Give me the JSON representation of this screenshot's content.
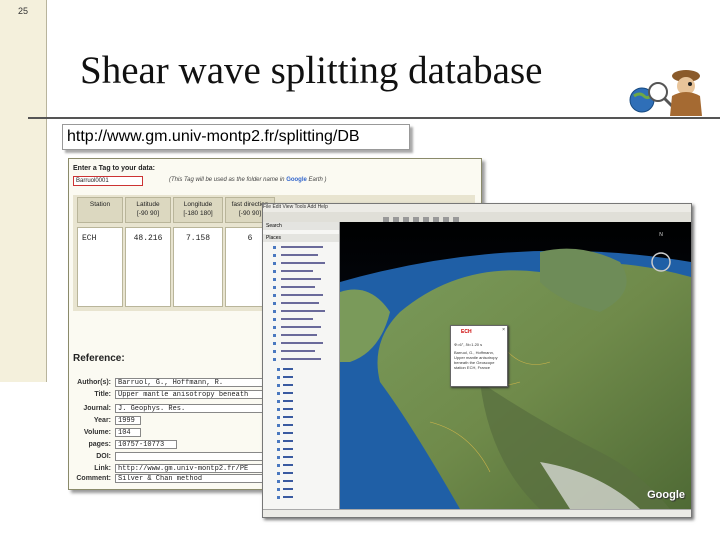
{
  "slide": {
    "number": "25",
    "title": "Shear wave splitting database",
    "url": "http://www.gm.univ-montp2.fr/splitting/DB"
  },
  "form": {
    "tag_label": "Enter a Tag to your data:",
    "tag_value": "Barruol0001",
    "tag_note": "(This Tag will be used as the folder name in",
    "tag_note_brand": "Google",
    "tag_note_end": "Earth )",
    "columns": [
      {
        "label": "Station",
        "range": ""
      },
      {
        "label": "Latitude",
        "range": "[-90 90]"
      },
      {
        "label": "Longitude",
        "range": "[-180 180]"
      },
      {
        "label": "fast direction",
        "range": "[-90 90]"
      }
    ],
    "row": [
      "ECH",
      "48.216",
      "7.158",
      "6"
    ],
    "reference_title": "Reference:",
    "fields": [
      {
        "label": "Author(s):",
        "value": "Barruol, G., Hoffmann, R."
      },
      {
        "label": "Title:",
        "value": "Upper mantle anisotropy beneath"
      },
      {
        "label": "Journal:",
        "value": "J. Geophys. Res."
      },
      {
        "label": "Year:",
        "value": "1999"
      },
      {
        "label": "Volume:",
        "value": "104"
      },
      {
        "label": "pages:",
        "value": "10757-10773"
      },
      {
        "label": "DOI:",
        "value": ""
      },
      {
        "label": "Link:",
        "value": "http://www.gm.univ-montp2.fr/PE"
      },
      {
        "label": "Comment:",
        "value": "Silver & Chan method"
      }
    ]
  },
  "earth": {
    "menu": "File  Edit  View  Tools  Add  Help",
    "search_tab": "Search",
    "places_tab": "Places",
    "popup_station": "ECH",
    "popup_lines": [
      "Φ=6°, δt=1.20 s",
      "Barruol, G., Hoffmann,",
      "Upper mantle anisotropy",
      "beneath the Geoscope",
      "station ECH, France"
    ],
    "google_logo": "Google",
    "colors": {
      "ocean": "#1f5fa6",
      "land": "#6f8a4a",
      "sky": "#000000"
    }
  }
}
